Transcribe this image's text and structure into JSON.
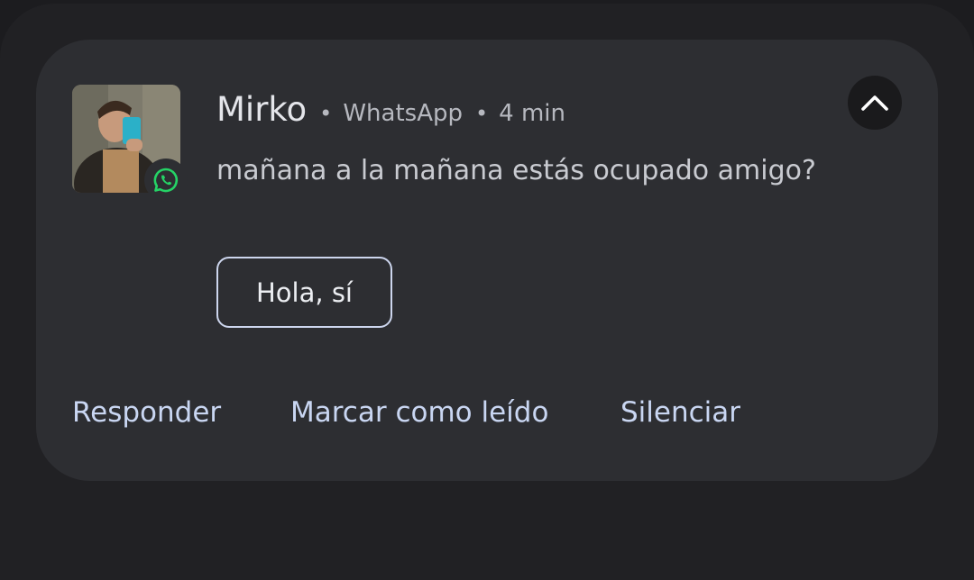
{
  "notification": {
    "sender": "Mirko",
    "separator": "•",
    "app_name": "WhatsApp",
    "time": "4 min",
    "message": "mañana a la mañana estás ocupado amigo?",
    "avatar_icon": "contact-photo",
    "app_icon": "whatsapp-icon",
    "expand_icon": "chevron-up-icon",
    "smart_reply": "Hola, sí",
    "actions": [
      {
        "label": "Responder"
      },
      {
        "label": "Marcar como leído"
      },
      {
        "label": "Silenciar"
      }
    ]
  },
  "colors": {
    "background": "#1c1c1f",
    "card": "#2d2e32",
    "accent_text": "#c9d6f2",
    "whatsapp_green": "#25d366"
  }
}
